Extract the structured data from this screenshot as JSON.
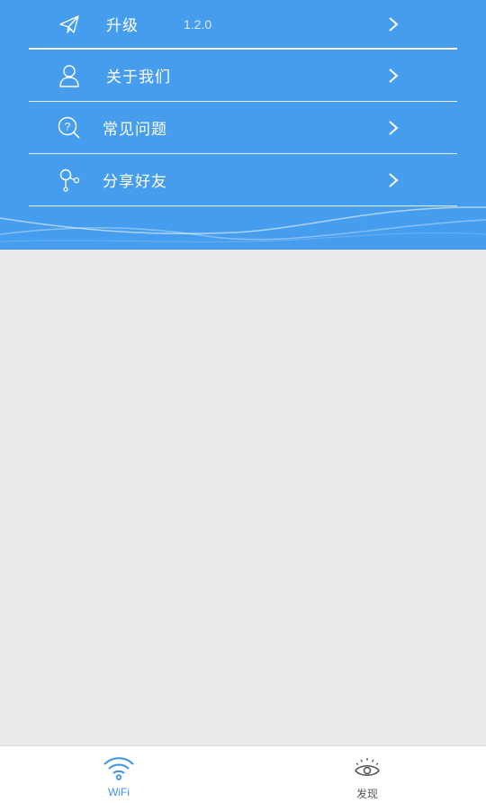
{
  "menu": {
    "items": [
      {
        "label": "升级",
        "icon": "paper-plane-icon",
        "value": "1.2.0"
      },
      {
        "label": "关于我们",
        "icon": "person-icon"
      },
      {
        "label": "常见问题",
        "icon": "question-search-icon"
      },
      {
        "label": "分享好友",
        "icon": "share-icon"
      }
    ]
  },
  "tabbar": {
    "tabs": [
      {
        "label": "WiFi",
        "icon": "wifi-icon",
        "active": true
      },
      {
        "label": "发现",
        "icon": "eye-icon",
        "active": false
      }
    ]
  },
  "colors": {
    "header_bg": "#479ded",
    "content_bg": "#eaeaea",
    "active_tab": "#3b92e8",
    "inactive_tab": "#555555"
  }
}
